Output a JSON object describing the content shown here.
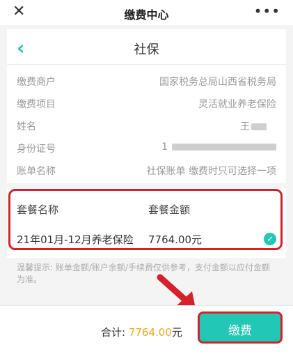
{
  "titlebar": {
    "close_icon": "close-icon",
    "title": "缴费中心",
    "more_icon": "more-icon"
  },
  "nav": {
    "back_icon": "chevron-left-icon",
    "title": "社保"
  },
  "info": [
    {
      "label": "缴费商户",
      "value": "国家税务总局山西省税务局"
    },
    {
      "label": "缴费项目",
      "value": "灵活就业养老保险"
    },
    {
      "label": "姓名",
      "value": "王"
    },
    {
      "label": "身份证号",
      "value": "1"
    },
    {
      "label": "账单名称",
      "value": "社保账单 缴费时只可选择一项"
    }
  ],
  "plans": {
    "header_name": "套餐名称",
    "header_amount": "套餐金额",
    "items": [
      {
        "name": "21年01月-12月养老保险",
        "amount": "7764.00元",
        "selected": true
      }
    ]
  },
  "tip": "温馨提示: 账单金额/账户余额/手续费仅供参考，支付金额以应付金额为准。",
  "footer": {
    "total_label": "合计: ",
    "total_amount": "7764.00",
    "total_unit": "元",
    "pay_label": "缴费"
  },
  "colors": {
    "accent": "#22c7b5",
    "highlight": "#d8202a",
    "amount": "#f0a81a"
  }
}
